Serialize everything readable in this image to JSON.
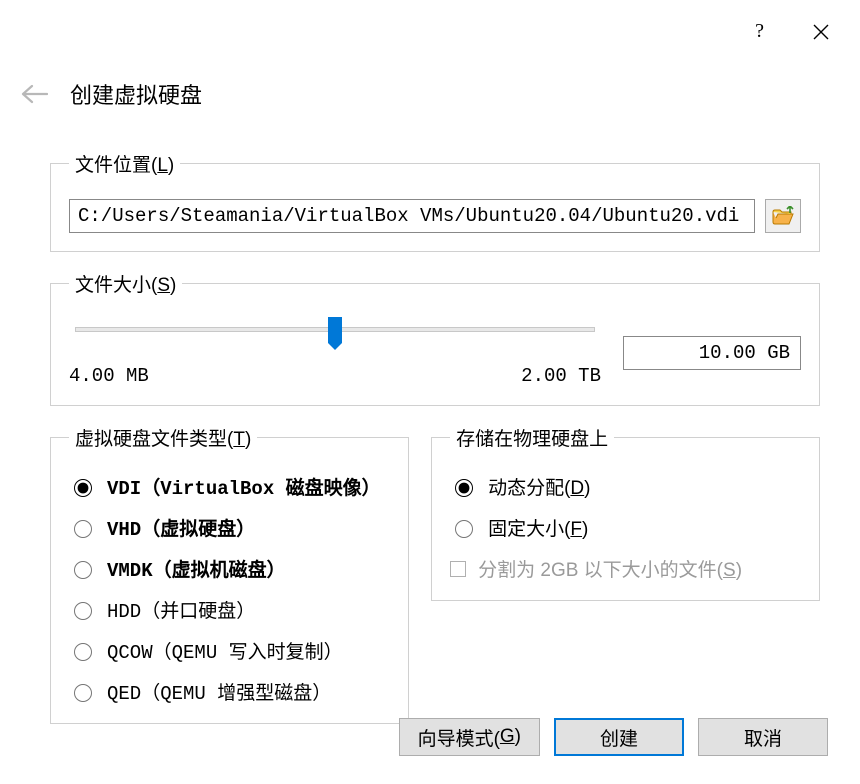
{
  "titlebar": {
    "help_label": "?"
  },
  "header": {
    "back_icon": "arrow-left",
    "title": "创建虚拟硬盘"
  },
  "file_location": {
    "legend_prefix": "文件位置(",
    "legend_key": "L",
    "legend_suffix": ")",
    "path": "C:/Users/Steamania/VirtualBox VMs/Ubuntu20.04/Ubuntu20.vdi",
    "browse_icon": "folder-open"
  },
  "file_size": {
    "legend_prefix": "文件大小(",
    "legend_key": "S",
    "legend_suffix": ")",
    "min_label": "4.00 MB",
    "max_label": "2.00 TB",
    "value_display": "10.00 GB",
    "thumb_percent": 50
  },
  "disk_type": {
    "legend_prefix": "虚拟硬盘文件类型(",
    "legend_key": "T",
    "legend_suffix": ")",
    "options": [
      {
        "label": "VDI（VirtualBox 磁盘映像）",
        "selected": true
      },
      {
        "label": "VHD（虚拟硬盘）",
        "selected": false
      },
      {
        "label": "VMDK（虚拟机磁盘）",
        "selected": false
      },
      {
        "label": "HDD（并口硬盘）",
        "selected": false
      },
      {
        "label": "QCOW（QEMU 写入时复制）",
        "selected": false
      },
      {
        "label": "QED（QEMU 增强型磁盘）",
        "selected": false
      }
    ]
  },
  "storage": {
    "legend": "存储在物理硬盘上",
    "options": [
      {
        "prefix": "动态分配(",
        "key": "D",
        "suffix": ")",
        "selected": true
      },
      {
        "prefix": "固定大小(",
        "key": "F",
        "suffix": ")",
        "selected": false
      }
    ],
    "split": {
      "prefix": "分割为 2GB 以下大小的文件(",
      "key": "S",
      "suffix": ")",
      "enabled": false
    }
  },
  "footer": {
    "wizard_prefix": "向导模式(",
    "wizard_key": "G",
    "wizard_suffix": ")",
    "create": "创建",
    "cancel": "取消"
  }
}
